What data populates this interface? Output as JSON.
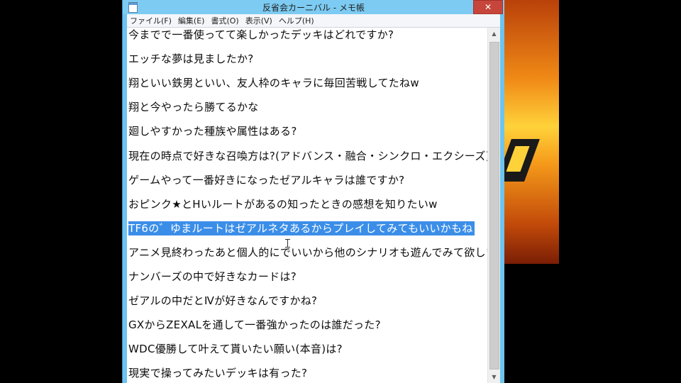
{
  "window": {
    "title": "反省会カーニバル - メモ帳",
    "close_glyph": "✕"
  },
  "menu": [
    {
      "label": "ファイル(F)"
    },
    {
      "label": "編集(E)"
    },
    {
      "label": "書式(O)"
    },
    {
      "label": "表示(V)"
    },
    {
      "label": "ヘルプ(H)"
    }
  ],
  "editor": {
    "lines": [
      {
        "text": "今までで一番使ってて楽しかったデッキはどれですか?"
      },
      {
        "text": "エッチな夢は見ましたか?"
      },
      {
        "text": "翔といい鉄男といい、友人枠のキャラに毎回苦戦してたねw"
      },
      {
        "text": "翔と今やったら勝てるかな"
      },
      {
        "text": "廻しやすかった種族や属性はある?"
      },
      {
        "text": "現在の時点で好きな召喚方は?(アドバンス・融合・シンクロ・エクシーズ)"
      },
      {
        "text": "ゲームやって一番好きになったゼアルキャラは誰ですか?"
      },
      {
        "text": "おピンク★とHいルートがあるの知ったときの感想を知りたいw"
      },
      {
        "text": "TF6の゛ゆまルートはゼアルネタあるからプレイしてみてもいいかもね",
        "selected": true
      },
      {
        "text": "アニメ見終わったあと個人的にでいいから他のシナリオも遊んでみて欲しいな"
      },
      {
        "text": "ナンバーズの中で好きなカードは?"
      },
      {
        "text": "ゼアルの中だとⅣが好きなんですかね?"
      },
      {
        "text": "GXからZEXALを通して一番強かったのは誰だった?"
      },
      {
        "text": "WDC優勝して叶えて貰いたい願い(本音)は?"
      },
      {
        "text": "現実で操ってみたいデッキは有った?"
      }
    ]
  },
  "scrollbar": {
    "up_glyph": "▲",
    "down_glyph": "▼"
  },
  "colors": {
    "selection": "#3b8ee8",
    "title_bar": "#7dcbf2",
    "close_button": "#c7463c"
  },
  "icons": [
    "notepad-icon",
    "close-icon",
    "scroll-up-arrow-icon",
    "scroll-down-arrow-icon",
    "text-cursor-icon"
  ]
}
